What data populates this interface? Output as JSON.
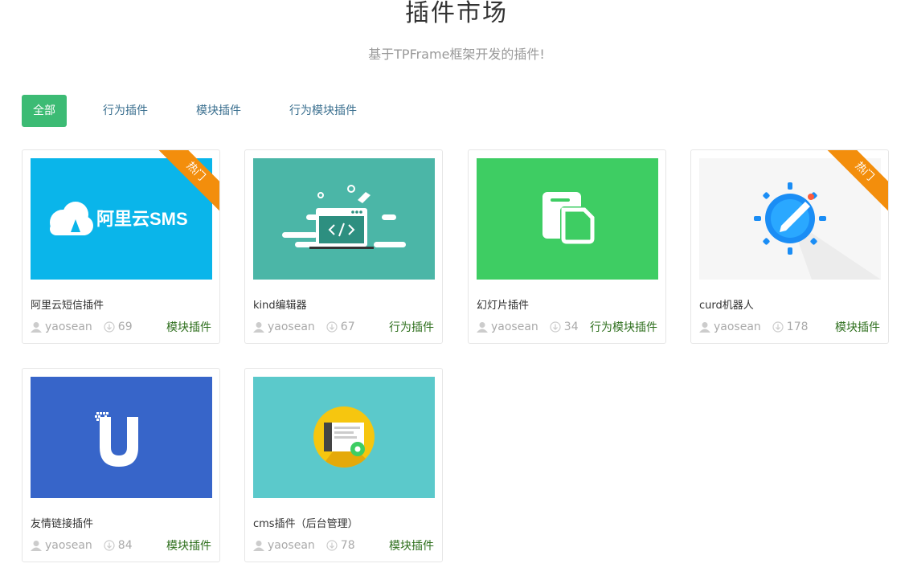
{
  "header": {
    "title": "插件市场",
    "subtitle": "基于TPFrame框架开发的插件!"
  },
  "filters": [
    {
      "label": "全部",
      "active": true
    },
    {
      "label": "行为插件",
      "active": false
    },
    {
      "label": "模块插件",
      "active": false
    },
    {
      "label": "行为模块插件",
      "active": false
    }
  ],
  "cards": [
    {
      "name": "阿里云短信插件",
      "author": "yaosean",
      "downloads": "69",
      "type": "模块插件",
      "hot": true,
      "hot_label": "热门",
      "thumb_text": "阿里云SMS",
      "bg": "#0ab5ea"
    },
    {
      "name": "kind编辑器",
      "author": "yaosean",
      "downloads": "67",
      "type": "行为插件",
      "hot": false,
      "bg": "#4bb6a7"
    },
    {
      "name": "幻灯片插件",
      "author": "yaosean",
      "downloads": "34",
      "type": "行为模块插件",
      "hot": false,
      "bg": "#3ecd63"
    },
    {
      "name": "curd机器人",
      "author": "yaosean",
      "downloads": "178",
      "type": "模块插件",
      "hot": true,
      "hot_label": "热门",
      "bg": "#f6f6f6"
    },
    {
      "name": "友情链接插件",
      "author": "yaosean",
      "downloads": "84",
      "type": "模块插件",
      "hot": false,
      "bg": "#3765c9"
    },
    {
      "name": "cms插件（后台管理）",
      "author": "yaosean",
      "downloads": "78",
      "type": "模块插件",
      "hot": false,
      "bg": "#5bc9cb"
    }
  ],
  "colors": {
    "accent": "#3cbb74",
    "type_text": "#2e6f1d",
    "ribbon": "#f38e0c",
    "tab_text": "#3a6f8f"
  },
  "icons": {
    "author": "user-icon",
    "downloads": "download-icon"
  }
}
